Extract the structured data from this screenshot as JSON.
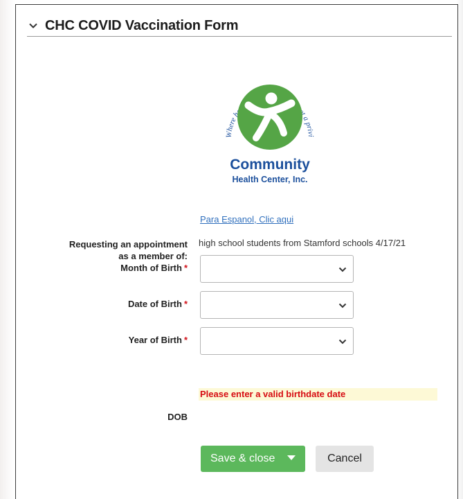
{
  "form": {
    "title": "CHC COVID Vaccination Form",
    "espanol_link": "Para Espanol, Clic aqui",
    "membership_label_line1": "Requesting an appointment",
    "membership_label_line2": "as a member of:",
    "membership_value": "high school students from Stamford schools 4/17/21",
    "month_label": "Month of Birth",
    "date_label": "Date of Birth",
    "year_label": "Year of Birth",
    "required_marker": "*",
    "month_value": "",
    "date_value": "",
    "year_value": "",
    "error_message": "Please enter a valid birthdate date",
    "dob_label": "DOB",
    "dob_value": ""
  },
  "logo": {
    "arc_text": "Where health care is a right, not a privilege, since 1972.",
    "name_line1": "Community",
    "name_line2": "Health Center, Inc.",
    "green": "#55a546",
    "blue": "#1b4f9c"
  },
  "buttons": {
    "save": "Save & close",
    "cancel": "Cancel"
  },
  "colors": {
    "accent_green": "#5cb85c",
    "error_red": "#d60b11",
    "link_blue": "#2f6fbd"
  }
}
